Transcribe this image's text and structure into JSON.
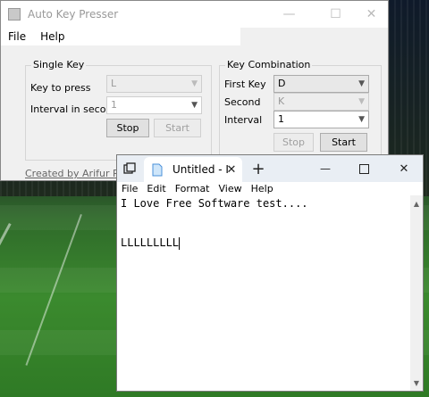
{
  "akp": {
    "title": "Auto Key Presser",
    "menu": [
      "File",
      "Help"
    ],
    "single_key": {
      "legend": "Single Key",
      "key_label": "Key to press",
      "key_value": "L",
      "interval_label": "Interval in seconds",
      "interval_value": "1",
      "stop_label": "Stop",
      "start_label": "Start"
    },
    "combo": {
      "legend": "Key Combination",
      "first_label": "First Key",
      "first_value": "D",
      "second_label": "Second",
      "second_value": "K",
      "interval_label": "Interval",
      "interval_value": "1",
      "stop_label": "Stop",
      "start_label": "Start"
    },
    "credit": "Created by Arifur Rahman"
  },
  "notepad": {
    "tab_title": "Untitled - I",
    "menu": [
      "File",
      "Edit",
      "Format",
      "View",
      "Help"
    ],
    "lines": [
      "I Love Free Software test....",
      "",
      "LLLLLLLLL"
    ]
  }
}
